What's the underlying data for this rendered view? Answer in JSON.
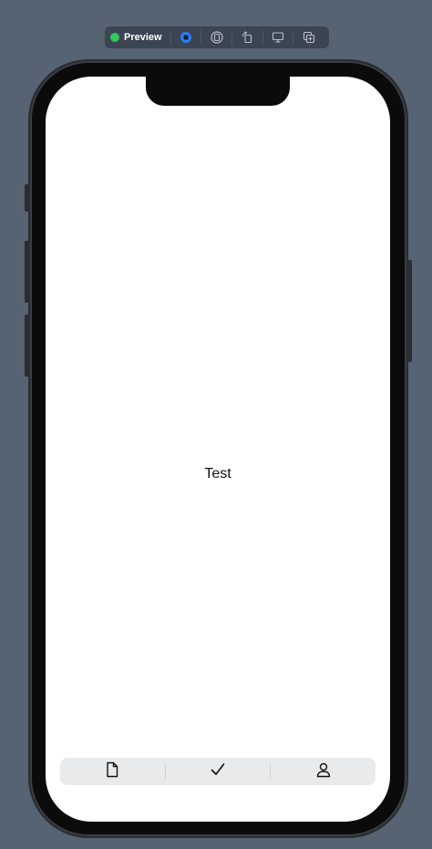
{
  "toolbar": {
    "status_label": "Preview",
    "status_color": "#35c759",
    "accent_color": "#2b7cf6",
    "buttons": [
      {
        "name": "live-mode",
        "icon": "live-icon",
        "selected": true
      },
      {
        "name": "selectable-mode",
        "icon": "selectable-icon",
        "selected": false
      },
      {
        "name": "rotate",
        "icon": "rotate-icon",
        "selected": false
      },
      {
        "name": "device-settings",
        "icon": "display-icon",
        "selected": false
      },
      {
        "name": "duplicate",
        "icon": "duplicate-icon",
        "selected": false
      }
    ]
  },
  "screen": {
    "content_text": "Test"
  },
  "tabbar": {
    "tabs": [
      {
        "name": "document",
        "icon": "document-icon"
      },
      {
        "name": "checkmark",
        "icon": "checkmark-icon"
      },
      {
        "name": "profile",
        "icon": "person-icon"
      }
    ]
  }
}
